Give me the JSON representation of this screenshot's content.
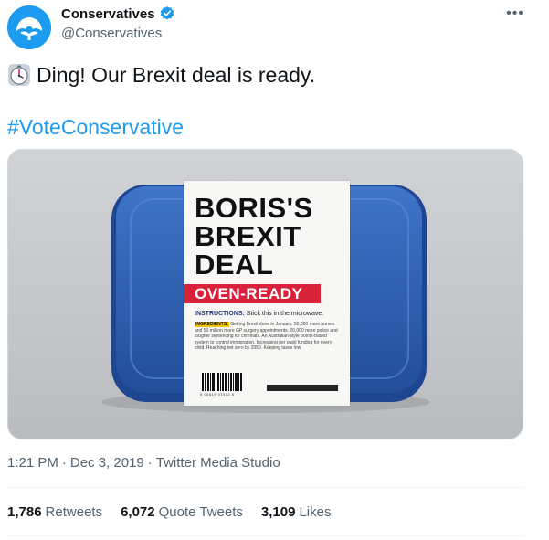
{
  "account": {
    "display_name": "Conservatives",
    "handle": "@Conservatives",
    "verified_icon": "verified-badge-icon",
    "avatar_icon": "conservative-tree-logo",
    "brand_color": "#1d9bf0"
  },
  "more_icon": "more-options-icon",
  "tweet": {
    "emoji_icon": "timer-clock-icon",
    "text": "Ding! Our Brexit deal is ready.",
    "hashtag": "#VoteConservative",
    "link_color": "#1d9bf0"
  },
  "media": {
    "title_line1": "BORIS'S",
    "title_line2": "BREXIT",
    "title_line3": "DEAL",
    "banner": "OVEN-READY",
    "instructions_label": "INSTRUCTIONS:",
    "instructions_text": "Stick this in the microwave.",
    "ingredients_label": "INGREDIENTS:",
    "ingredients_text": "Getting Brexit done in January. 50,000 more nurses and 50 million more GP surgery appointments. 20,000 more police and tougher sentencing for criminals. An Australian-style points-based system to control immigration. Increasing per pupil funding for every child. Reaching net zero by 2050. Keeping taxes low.",
    "barcode_number": "5 00819 07002 6",
    "banner_color": "#d9213a",
    "container_color": "#2f63b7"
  },
  "timestamp": {
    "time": "1:21 PM",
    "separator1": "·",
    "date": "Dec 3, 2019",
    "separator2": "·",
    "source": "Twitter Media Studio"
  },
  "stats": {
    "retweets_count": "1,786",
    "retweets_label": "Retweets",
    "quotes_count": "6,072",
    "quotes_label": "Quote Tweets",
    "likes_count": "3,109",
    "likes_label": "Likes"
  }
}
